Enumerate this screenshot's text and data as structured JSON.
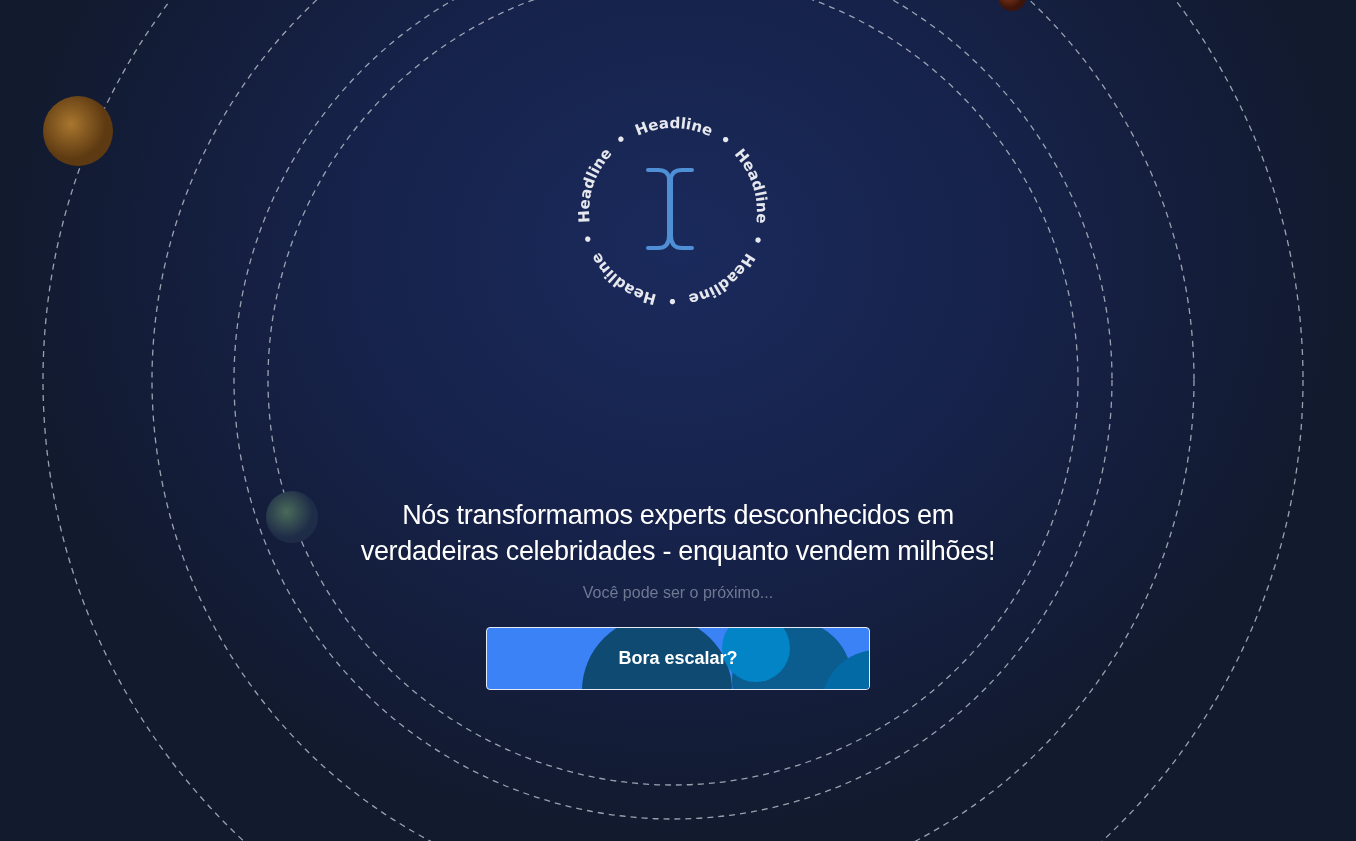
{
  "badge": {
    "ring_words": [
      "Headline",
      "Headline",
      "Headline",
      "Headline",
      "Headline"
    ],
    "separator": "•"
  },
  "hero": {
    "headline_lines": [
      "Nós transformamos experts desconhecidos em",
      "verdadeiras celebridades - enquanto vendem milhões!"
    ],
    "subtitle": "Você pode ser o próximo...",
    "cta": "Bora escalar?"
  }
}
